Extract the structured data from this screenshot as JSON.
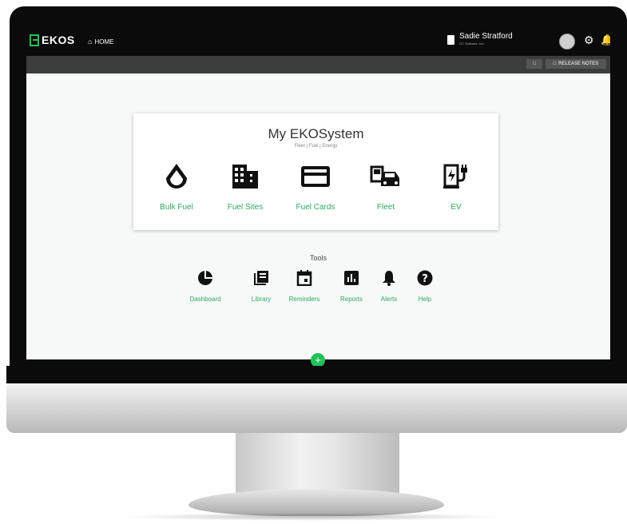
{
  "app": {
    "logo_text": "EKOS",
    "accent": "#22c25a"
  },
  "nav": {
    "home_label": "HOME"
  },
  "user": {
    "name": "Sadie Stratford",
    "org": "GC Software, Inc."
  },
  "subbar": {
    "release_notes": "RELEASE NOTES"
  },
  "system": {
    "title": "My EKOSystem",
    "subtitle": "Fleet | Fuel | Energy"
  },
  "modules": [
    {
      "label": "Bulk Fuel",
      "icon": "drop-icon"
    },
    {
      "label": "Fuel Sites",
      "icon": "building-icon"
    },
    {
      "label": "Fuel Cards",
      "icon": "card-icon"
    },
    {
      "label": "Fleet",
      "icon": "car-pump-icon"
    },
    {
      "label": "EV",
      "icon": "ev-charger-icon"
    }
  ],
  "tools": {
    "title": "Tools",
    "items": [
      {
        "label": "Dashboard",
        "icon": "pie-chart-icon"
      },
      {
        "label": "Library",
        "icon": "library-icon"
      },
      {
        "label": "Reminders",
        "icon": "calendar-icon"
      },
      {
        "label": "Reports",
        "icon": "bar-chart-icon"
      },
      {
        "label": "Alerts",
        "icon": "bell-icon"
      },
      {
        "label": "Help",
        "icon": "help-icon"
      }
    ]
  }
}
